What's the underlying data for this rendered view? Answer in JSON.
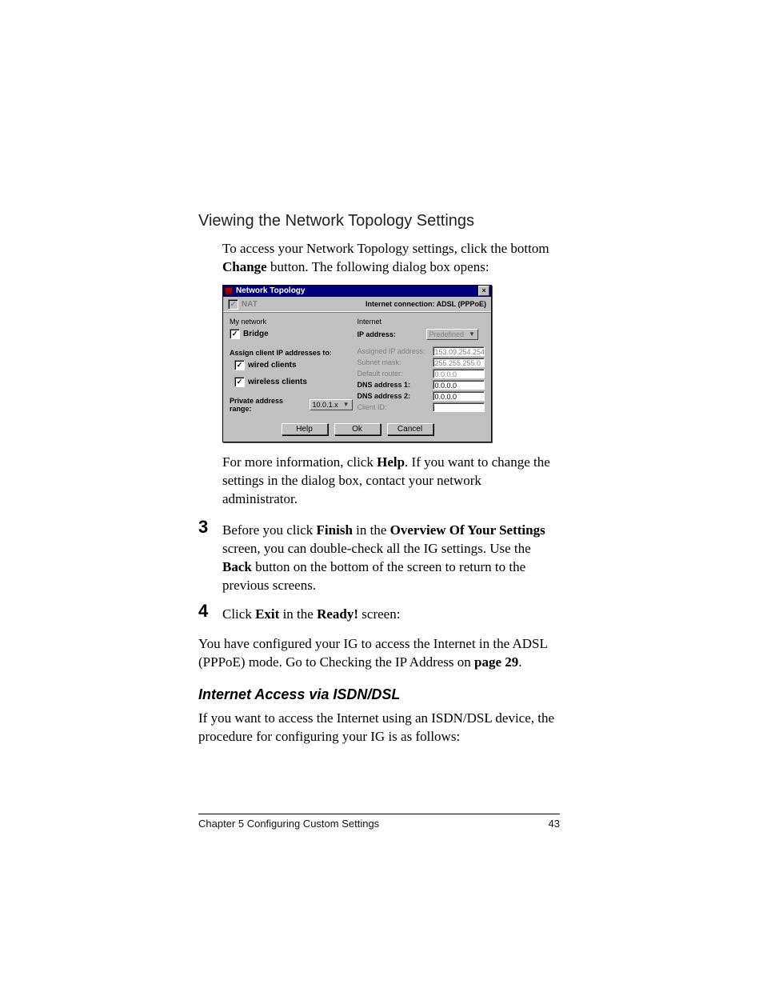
{
  "heading": "Viewing the Network Topology Settings",
  "intro": {
    "line1_a": "To access your Network Topology settings, click the bottom ",
    "change_b": "Change",
    "line1_b": " button. The following dialog box opens:"
  },
  "dialog": {
    "title": "Network Topology",
    "nat_label": "NAT",
    "conn_label": "Internet connection: ADSL (PPPoE)",
    "left": {
      "my_network": "My network",
      "bridge": "Bridge",
      "assign_label": "Assign client IP addresses to:",
      "wired": "wired clients",
      "wireless": "wireless clients",
      "private_range_label": "Private address range:",
      "private_range_value": "10.0.1.x"
    },
    "right": {
      "internet": "Internet",
      "ip_address_label": "IP address:",
      "ip_address_value": "Predefined",
      "rows": {
        "assigned_ip": {
          "label": "Assigned IP address:",
          "value": "153.09.254.254"
        },
        "subnet": {
          "label": "Subnet mask:",
          "value": "255.255.255.0"
        },
        "router": {
          "label": "Default router:",
          "value": "0.0.0.0"
        },
        "dns1": {
          "label": "DNS address 1:",
          "value": "0.0.0.0"
        },
        "dns2": {
          "label": "DNS address 2:",
          "value": "0.0.0.0"
        },
        "clientid": {
          "label": "Client ID:",
          "value": ""
        }
      }
    },
    "buttons": {
      "help": "Help",
      "ok": "Ok",
      "cancel": "Cancel"
    }
  },
  "post_dialog": {
    "a": "For more information, click ",
    "help_b": "Help",
    "b": ". If you want to change the settings in the dialog box, contact your network administrator."
  },
  "step3": {
    "num": "3",
    "a": "Before you click ",
    "finish_b": "Finish",
    "b": " in the ",
    "overview_b": "Overview Of Your Settings",
    "c": " screen, you can double-check all the IG settings. Use the ",
    "back_b": "Back",
    "d": " button on the bottom of the screen to return to the previous screens."
  },
  "step4": {
    "num": "4",
    "a": "Click ",
    "exit_b": "Exit",
    "b": " in the ",
    "ready_b": "Ready!",
    "c": " screen:"
  },
  "after_steps": {
    "a": "You have configured your IG to access the Internet in the ADSL (PPPoE) mode. Go to Checking the IP Address on ",
    "page_b": "page 29",
    "b": "."
  },
  "subheading": "Internet Access via ISDN/DSL",
  "sub_para": "If you want to access the Internet using an ISDN/DSL device, the procedure for configuring your IG is as follows:",
  "footer": {
    "chapter": "Chapter 5    Configuring Custom Settings",
    "page": "43"
  }
}
